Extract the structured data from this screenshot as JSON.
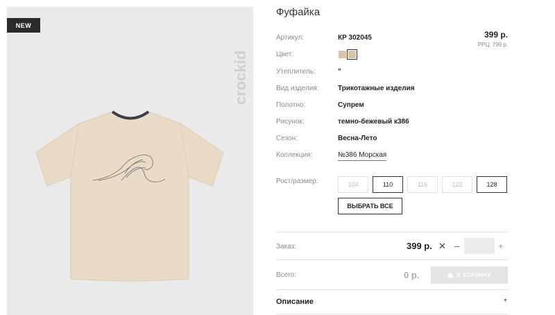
{
  "product": {
    "badge": "NEW",
    "brand": "crockid",
    "title": "Фуфайка",
    "price": "399 р.",
    "rrc": "РРЦ: 799 р.",
    "colors": [
      "#d8c4a6",
      "#d8c4a6"
    ],
    "attributes": [
      {
        "label": "Артикул:",
        "value": "КР 302045"
      },
      {
        "label": "Цвет:",
        "value": ""
      },
      {
        "label": "Утеплитель:",
        "value": "\""
      },
      {
        "label": "Вид изделия:",
        "value": "Трикотажные изделия"
      },
      {
        "label": "Полотно:",
        "value": "Супрем"
      },
      {
        "label": "Рисунок:",
        "value": "темно-бежевый к386"
      },
      {
        "label": "Сезон:",
        "value": "Весна-Лето"
      },
      {
        "label": "Коллекция:",
        "value": "№386 Морская"
      }
    ],
    "size_label": "Рост/размер:",
    "sizes": [
      {
        "label": "104",
        "available": false
      },
      {
        "label": "110",
        "available": true
      },
      {
        "label": "116",
        "available": false
      },
      {
        "label": "122",
        "available": false
      },
      {
        "label": "128",
        "available": true
      }
    ],
    "select_all": "ВЫБРАТЬ ВСЕ"
  },
  "order": {
    "label": "Заказ:",
    "price": "399 р.",
    "qty": "",
    "minus": "–",
    "plus": "+",
    "remove": "✕"
  },
  "total": {
    "label": "Всего:",
    "value": "0 р.",
    "cart_button": "В КОРЗИНУ"
  },
  "description": {
    "label": "Описание"
  }
}
